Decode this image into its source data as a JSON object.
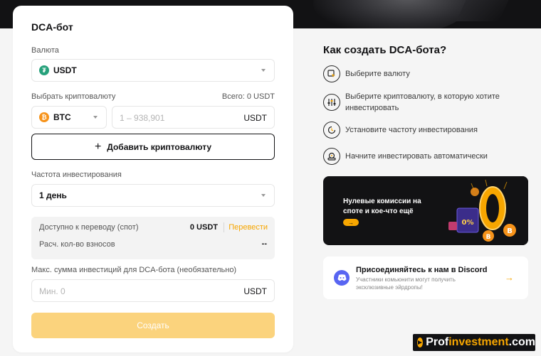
{
  "form": {
    "title": "DCA-бот",
    "currency_label": "Валюта",
    "currency_value": "USDT",
    "crypto_label": "Выбрать криптовалюту",
    "total_label": "Всего: 0 USDT",
    "crypto_value": "BTC",
    "amount_placeholder": "1 – 938,901",
    "amount_unit": "USDT",
    "add_crypto": "Добавить криптовалюту",
    "frequency_label": "Частота инвестирования",
    "frequency_value": "1 день",
    "available_label": "Доступно к переводу (спот)",
    "available_value": "0 USDT",
    "transfer_link": "Перевести",
    "installments_label": "Расч. кол-во взносов",
    "installments_value": "--",
    "max_label": "Макс. сумма инвестиций для DCA-бота (необязательно)",
    "max_placeholder": "Мин. 0",
    "max_unit": "USDT",
    "create": "Создать"
  },
  "guide": {
    "title": "Как создать DCA-бота?",
    "steps": [
      {
        "icon": "select-currency-icon",
        "text": "Выберите валюту"
      },
      {
        "icon": "sliders-icon",
        "text": "Выберите криптовалюту, в которую хотите инвестировать"
      },
      {
        "icon": "clock-refresh-icon",
        "text": "Установите частоту инвестирования"
      },
      {
        "icon": "robot-icon",
        "text": "Начните инвестировать автоматически"
      }
    ]
  },
  "promo": {
    "line1": "Нулевые комиссии на",
    "line2": "споте и кое-что ещё",
    "badge": "0%"
  },
  "discord": {
    "title": "Присоединяйтесь к нам в Discord",
    "subtitle": "Участники комьюнити могут получить эксклюзивные эйрдропы!",
    "icon": "discord-icon"
  },
  "watermark": {
    "left": "Prof",
    "mid": "investment",
    "right": ".com"
  },
  "colors": {
    "accent": "#f7a600",
    "dark": "#121214",
    "create_button": "#fbd37d",
    "usdt": "#26a17b",
    "btc": "#f7931a",
    "discord": "#5865f2"
  }
}
